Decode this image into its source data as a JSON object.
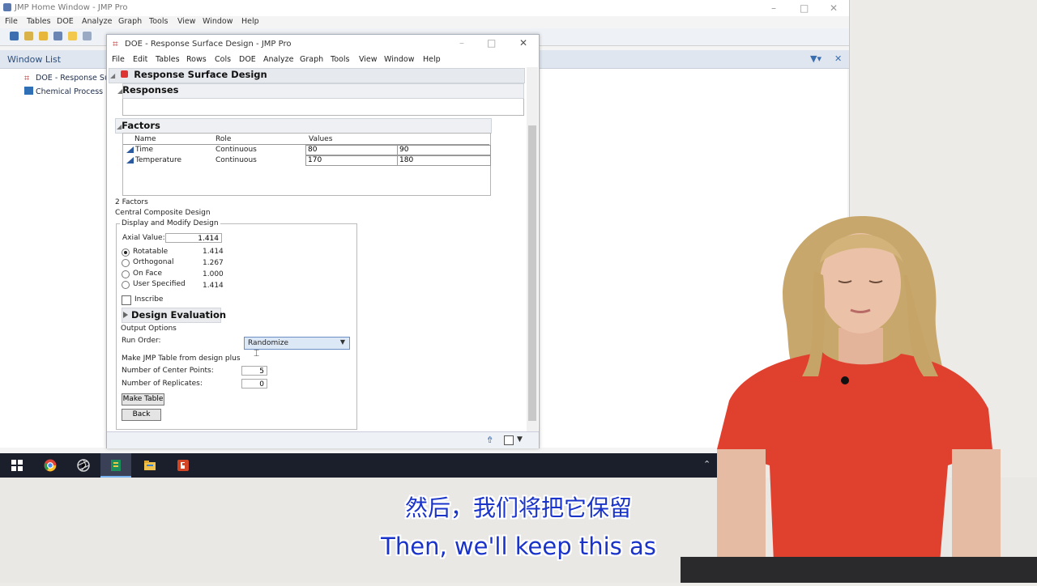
{
  "home_window": {
    "title": "JMP Home Window - JMP Pro",
    "menu": [
      "File",
      "Tables",
      "DOE",
      "Analyze",
      "Graph",
      "Tools",
      "View",
      "Window",
      "Help"
    ],
    "window_list_title": "Window List",
    "window_list_items": [
      "DOE - Response Surf",
      "Chemical Process"
    ]
  },
  "doe_window": {
    "title": "DOE - Response Surface Design - JMP Pro",
    "menu": [
      "File",
      "Edit",
      "Tables",
      "Rows",
      "Cols",
      "DOE",
      "Analyze",
      "Graph",
      "Tools",
      "View",
      "Window",
      "Help"
    ],
    "outline_title": "Response Surface Design",
    "responses_title": "Responses",
    "factors_title": "Factors",
    "factors_columns": [
      "Name",
      "Role",
      "Values"
    ],
    "factors": [
      {
        "name": "Time",
        "role": "Continuous",
        "low": "80",
        "high": "90"
      },
      {
        "name": "Temperature",
        "role": "Continuous",
        "low": "170",
        "high": "180"
      }
    ],
    "factor_count": "2 Factors",
    "design_type": "Central Composite Design",
    "display_modify": "Display and Modify Design",
    "axial_label": "Axial Value:",
    "axial_value": "1.414",
    "options": [
      {
        "label": "Rotatable",
        "value": "1.414",
        "selected": true
      },
      {
        "label": "Orthogonal",
        "value": "1.267",
        "selected": false
      },
      {
        "label": "On Face",
        "value": "1.000",
        "selected": false
      },
      {
        "label": "User Specified",
        "value": "1.414",
        "selected": false
      }
    ],
    "inscribe_label": "Inscribe",
    "design_evaluation": "Design Evaluation",
    "output_options": "Output Options",
    "run_order_label": "Run Order:",
    "run_order_value": "Randomize",
    "make_jmp_table": "Make JMP Table from design plus",
    "center_points_label": "Number of Center Points:",
    "center_points_value": "5",
    "replicates_label": "Number of Replicates:",
    "replicates_value": "0",
    "make_table_button": "Make Table",
    "back_button": "Back"
  },
  "subtitles": {
    "chinese": "然后，我们将把它保留",
    "english": "Then, we'll keep this as"
  },
  "colors": {
    "subtitle": "#1a33c8",
    "taskbar": "#1b1f2b",
    "shirt": "#e0412f"
  }
}
